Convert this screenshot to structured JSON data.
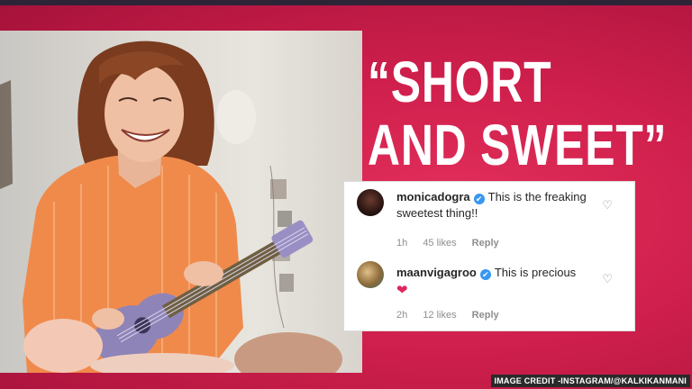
{
  "headline": {
    "line1": "“SHORT",
    "line2": "AND SWEET”"
  },
  "comments": [
    {
      "username": "monicadogra",
      "text": "This is the freaking sweetest thing!!",
      "time": "1h",
      "likes": "45 likes",
      "reply_label": "Reply",
      "avatar_icon": "avatar"
    },
    {
      "username": "maanvigagroo",
      "text": "This is precious",
      "emoji": "❤",
      "time": "2h",
      "likes": "12 likes",
      "reply_label": "Reply",
      "avatar_icon": "avatar"
    }
  ],
  "icons": {
    "verified": "✔",
    "like": "♡"
  },
  "credit": "IMAGE CREDIT -INSTAGRAM/@KALKIKANMANI",
  "colors": {
    "background": "#cf1f4c",
    "headline": "#ffffff",
    "verified": "#3897f0"
  }
}
